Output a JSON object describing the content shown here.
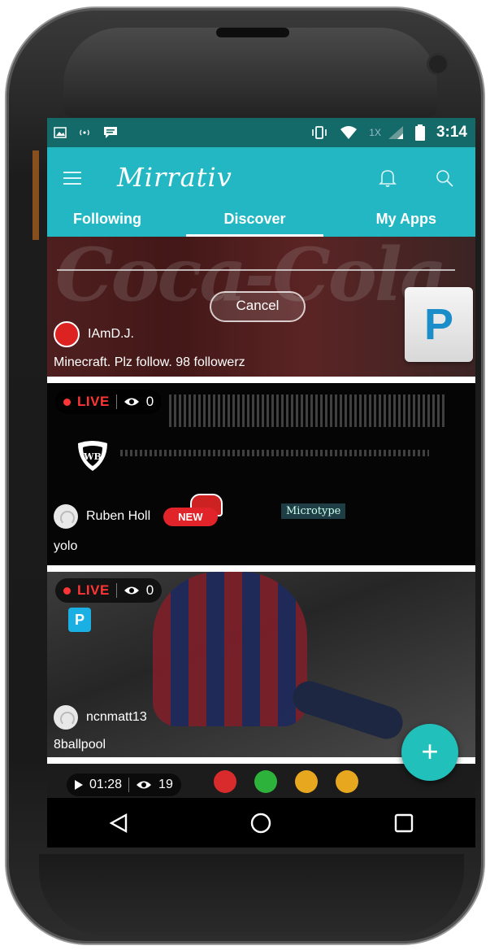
{
  "statusbar": {
    "time": "3:14",
    "network_label": "1X",
    "icons": [
      "image-icon",
      "wireless-icon",
      "chat-icon",
      "vibrate-icon",
      "wifi-icon",
      "signal-icon",
      "battery-icon"
    ]
  },
  "app": {
    "title": "Mirrativ",
    "icons": [
      "menu-icon",
      "bell-icon",
      "search-icon"
    ]
  },
  "tabs": [
    {
      "label": "Following",
      "active": false
    },
    {
      "label": "Discover",
      "active": true
    },
    {
      "label": "My Apps",
      "active": false
    }
  ],
  "share_overlay": {
    "cancel_label": "Cancel",
    "app_icon_letter": "P"
  },
  "feed": [
    {
      "user": "IAmD.J.",
      "caption": "Minecraft.  Plz follow. 98 followerz"
    },
    {
      "live_label": "LIVE",
      "viewers": "0",
      "user": "Ruben Holl",
      "badge": "NEW",
      "caption": "yolo",
      "watermark": "Microtype"
    },
    {
      "live_label": "LIVE",
      "viewers": "0",
      "user": "ncnmatt13",
      "caption": "8ballpool",
      "app_icon_letter": "P"
    },
    {
      "duration": "01:28",
      "views": "19"
    }
  ],
  "fab": {
    "label": "+"
  },
  "colors": {
    "statusbar": "#136a68",
    "appbar": "#22b7c2",
    "live": "#ff3535",
    "new_badge": "#e0242a",
    "fab": "#22c0ba"
  },
  "navbar": [
    "back-icon",
    "home-icon",
    "recents-icon"
  ]
}
